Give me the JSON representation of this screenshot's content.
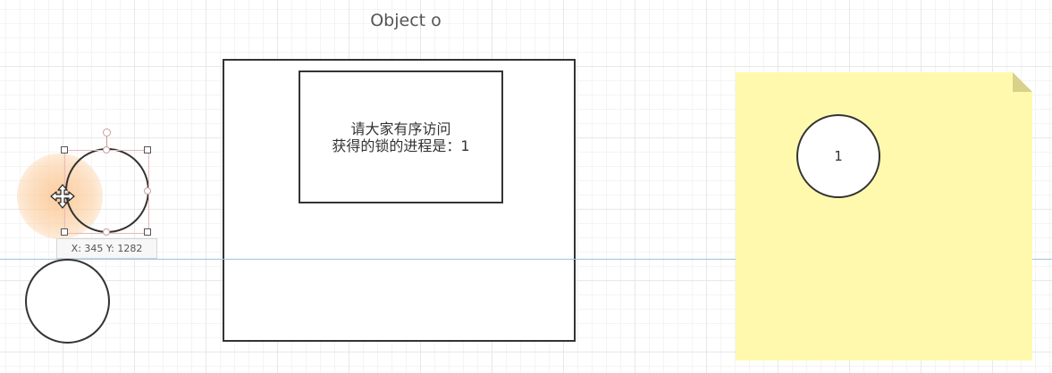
{
  "diagram": {
    "title": "Object o",
    "inner_box": {
      "line1": "请大家有序访问",
      "line2": "获得的锁的进程是：1"
    },
    "note": {
      "circle_label": "1",
      "color": "#fff9ae"
    },
    "selection": {
      "coords_text": "X: 345  Y: 1282"
    }
  },
  "colors": {
    "stroke": "#333333",
    "guide": "#9ec3db",
    "highlight": "#fcd6af"
  },
  "icons": {
    "cursor": "move-cursor-icon"
  }
}
